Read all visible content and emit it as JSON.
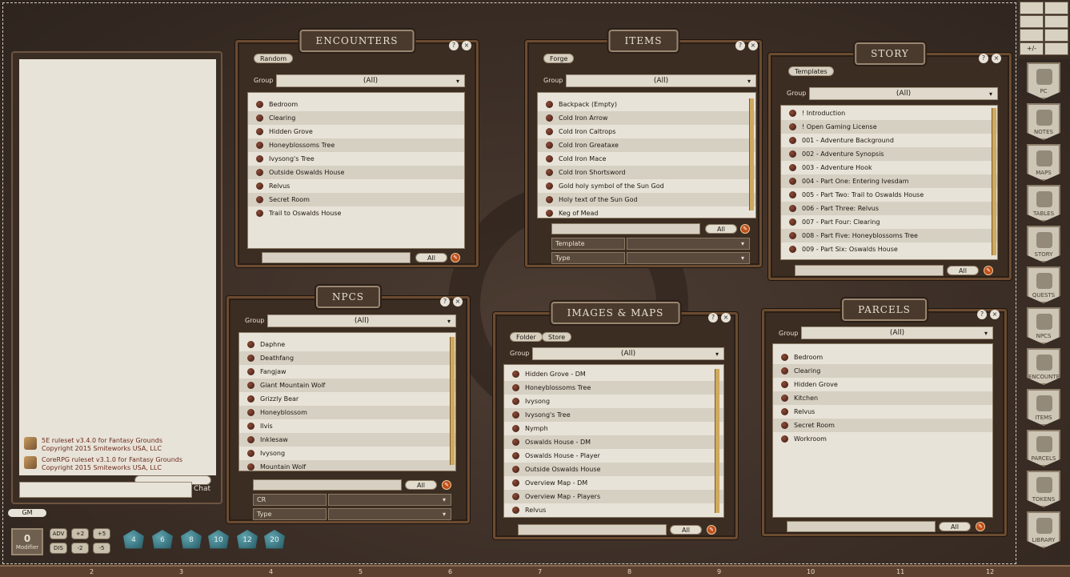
{
  "chat": {
    "messages": [
      {
        "line1": "5E ruleset v3.4.0 for Fantasy Grounds",
        "line2": "Copyright 2015 Smiteworks USA, LLC"
      },
      {
        "line1": "CoreRPG ruleset v3.1.0 for Fantasy Grounds",
        "line2": "Copyright 2015 Smiteworks USA, LLC"
      }
    ],
    "chat_button": "Chat",
    "gm_label": "GM"
  },
  "encounters": {
    "title": "ENCOUNTERS",
    "tab": "Random",
    "group_label": "Group",
    "group_value": "(All)",
    "items": [
      "Bedroom",
      "Clearing",
      "Hidden Grove",
      "Honeyblossoms Tree",
      "Ivysong's Tree",
      "Outside Oswalds House",
      "Relvus",
      "Secret Room",
      "Trail to Oswalds House"
    ],
    "all_button": "All"
  },
  "items": {
    "title": "ITEMS",
    "tab": "Forge",
    "group_label": "Group",
    "group_value": "(All)",
    "items": [
      "Backpack (Empty)",
      "Cold Iron Arrow",
      "Cold Iron Caltrops",
      "Cold Iron Greataxe",
      "Cold Iron Mace",
      "Cold Iron Shortsword",
      "Gold holy symbol of the Sun God",
      "Holy text of the Sun God",
      "Keg of Mead"
    ],
    "all_button": "All",
    "filters": [
      "Template",
      "Type"
    ]
  },
  "story": {
    "title": "STORY",
    "tab": "Templates",
    "group_label": "Group",
    "group_value": "(All)",
    "items": [
      "! Introduction",
      "! Open Gaming License",
      "001 - Adventure Background",
      "002 - Adventure Synopsis",
      "003 - Adventure Hook",
      "004 - Part One: Entering Ivesdam",
      "005 - Part Two: Trail to Oswalds House",
      "006 - Part Three: Relvus",
      "007 - Part Four: Clearing",
      "008 - Part Five: Honeyblossoms Tree",
      "009 - Part Six: Oswalds House"
    ],
    "all_button": "All"
  },
  "npcs": {
    "title": "NPCS",
    "group_label": "Group",
    "group_value": "(All)",
    "items": [
      "Daphne",
      "Deathfang",
      "Fangjaw",
      "Giant Mountain Wolf",
      "Grizzly Bear",
      "Honeyblossom",
      "Ilvis",
      "Inklesaw",
      "Ivysong",
      "Mountain Wolf"
    ],
    "all_button": "All",
    "filters": [
      "CR",
      "Type"
    ]
  },
  "images": {
    "title": "IMAGES & MAPS",
    "tabs": [
      "Folder",
      "Store"
    ],
    "group_label": "Group",
    "group_value": "(All)",
    "items": [
      "Hidden Grove - DM",
      "Honeyblossoms Tree",
      "Ivysong",
      "Ivysong's Tree",
      "Nymph",
      "Oswalds House - DM",
      "Oswalds House - Player",
      "Outside Oswalds House",
      "Overview Map - DM",
      "Overview Map - Players",
      "Relvus"
    ],
    "all_button": "All"
  },
  "parcels": {
    "title": "PARCELS",
    "group_label": "Group",
    "group_value": "(All)",
    "items": [
      "Bedroom",
      "Clearing",
      "Hidden Grove",
      "Kitchen",
      "Relvus",
      "Secret Room",
      "Workroom"
    ]
  },
  "sidebar": [
    "PC",
    "NOTES",
    "MAPS",
    "TABLES",
    "STORY",
    "QUESTS",
    "NPCS",
    "ENCOUNTERS",
    "ITEMS",
    "PARCELS",
    "TOKENS",
    "LIBRARY"
  ],
  "toolbar": [
    "",
    "",
    "",
    "",
    "",
    "",
    "",
    "+/-",
    ""
  ],
  "modifier": {
    "value": "0",
    "label": "Modifier"
  },
  "hotkeys": [
    "ADV",
    "+2",
    "+5",
    "DIS",
    "-2",
    "-5"
  ],
  "dice": [
    "4",
    "6",
    "8",
    "10",
    "12",
    "20"
  ],
  "ruler": [
    "2",
    "3",
    "4",
    "5",
    "6",
    "7",
    "8",
    "9",
    "10",
    "11",
    "12"
  ],
  "colors": {
    "leather": "#3e3129",
    "parchment": "#e8e3d8",
    "frame": "#6b4b30",
    "dice": "#2f7a86"
  }
}
